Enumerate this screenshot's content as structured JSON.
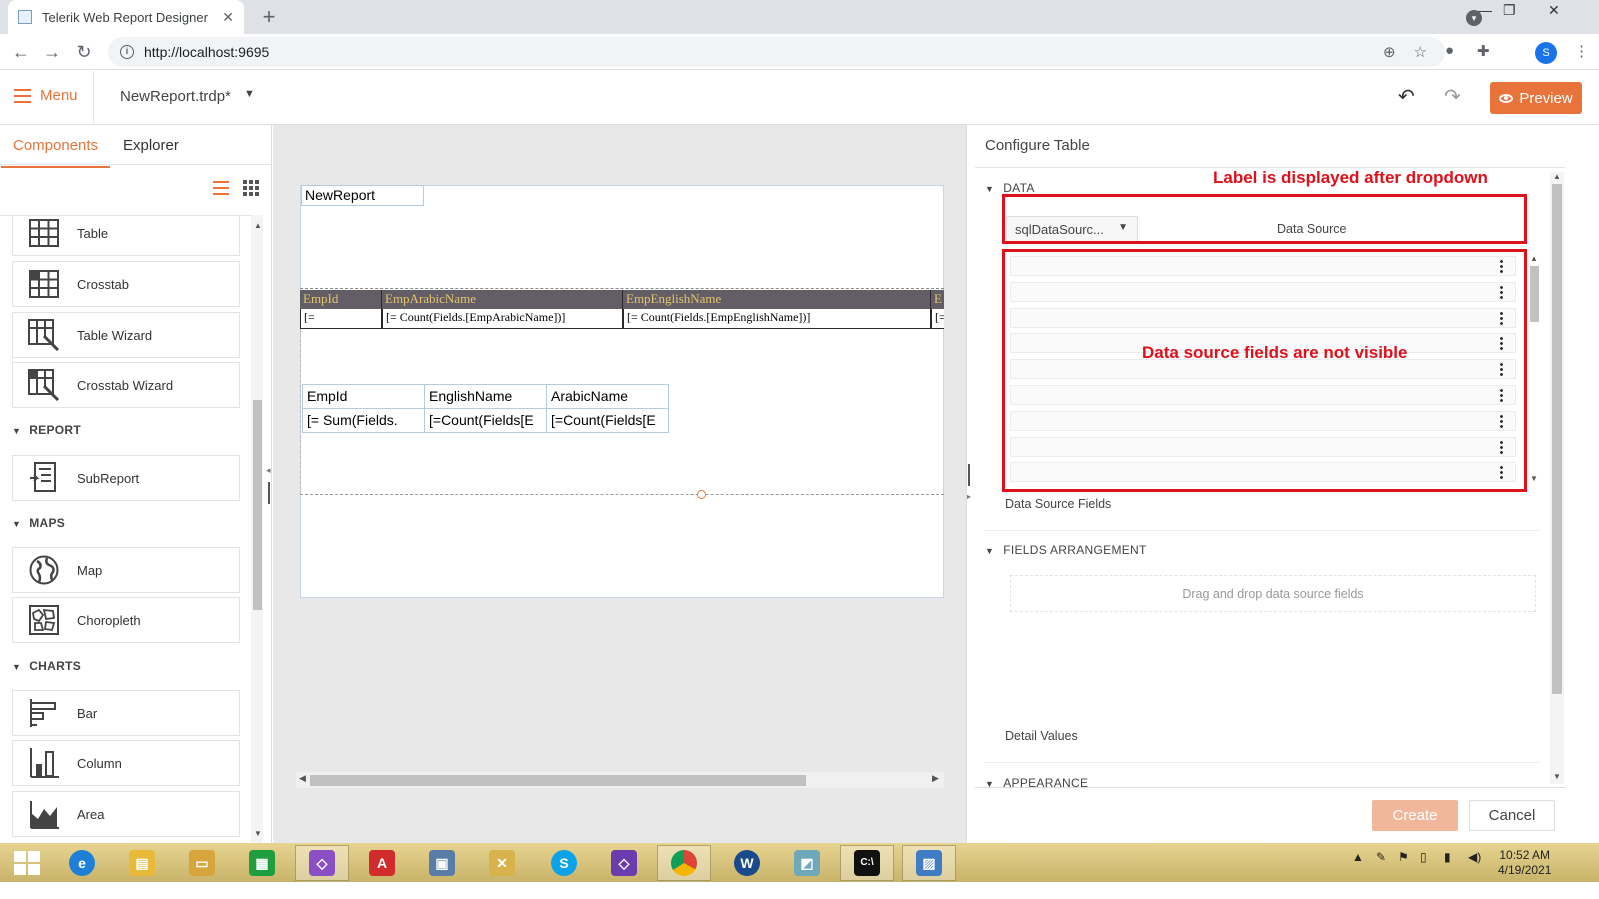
{
  "browser": {
    "tab_title": "Telerik Web Report Designer",
    "tab_close": "✕",
    "new_tab": "+",
    "url": "http://localhost:9695",
    "profile_initial": "S",
    "window_controls": [
      "—",
      "❐",
      "✕"
    ]
  },
  "header": {
    "menu_label": "Menu",
    "report_name": "NewReport.trdp*",
    "report_caret": "▼",
    "undo_icon": "↶",
    "redo_icon": "↷",
    "preview_label": "Preview"
  },
  "left_panel": {
    "tabs": [
      "Components",
      "Explorer"
    ],
    "items_top": [
      "Table",
      "Crosstab",
      "Table Wizard",
      "Crosstab Wizard"
    ],
    "section_report": "REPORT",
    "items_report": [
      "SubReport"
    ],
    "section_maps": "MAPS",
    "items_maps": [
      "Map",
      "Choropleth"
    ],
    "section_charts": "CHARTS",
    "items_charts": [
      "Bar",
      "Column",
      "Area"
    ]
  },
  "design": {
    "report_title": "NewReport",
    "table1_headers": [
      "EmpId",
      "EmpArabicName",
      "EmpEnglishName",
      "E"
    ],
    "table1_cells": [
      "[=",
      "[= Count(Fields.[EmpArabicName])]",
      "[= Count(Fields.[EmpEnglishName])]",
      "[="
    ],
    "table2_headers": [
      "EmpId",
      "EnglishName",
      "ArabicName"
    ],
    "table2_cells": [
      "[= Sum(Fields.",
      "[=Count(Fields[E",
      "[=Count(Fields[E"
    ]
  },
  "configure": {
    "title": "Configure Table",
    "section_data": "DATA",
    "data_source_value": "sqlDataSourc...",
    "data_source_label": "Data Source",
    "data_source_fields_label": "Data Source Fields",
    "field_rows": 9,
    "section_fields_arrangement": "FIELDS ARRANGEMENT",
    "dropzone_text": "Drag and drop data source fields",
    "detail_values_label": "Detail Values",
    "section_appearance": "APPEARANCE",
    "create_label": "Create",
    "cancel_label": "Cancel"
  },
  "annotations": {
    "label_after_dropdown": "Label is displayed after dropdown",
    "fields_not_visible": "Data source fields are not visible"
  },
  "taskbar": {
    "clock_time": "10:52 AM",
    "clock_date": "4/19/2021"
  }
}
